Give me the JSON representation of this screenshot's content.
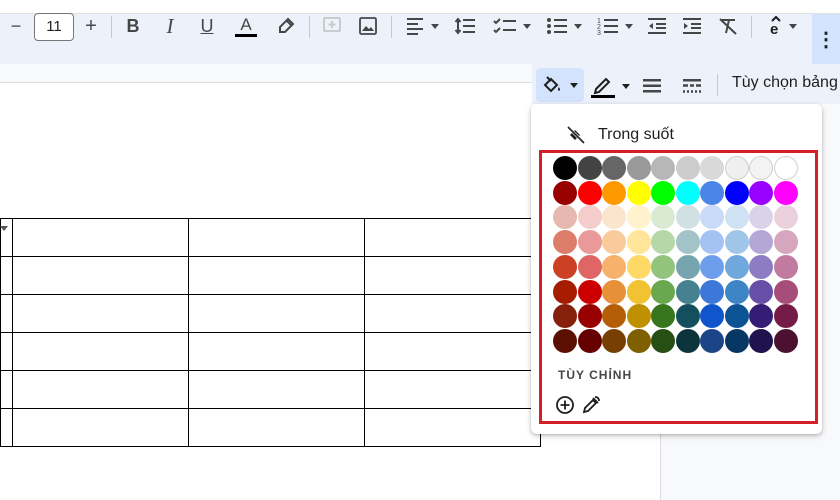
{
  "toolbar": {
    "font_size": "11",
    "minus": "−",
    "plus": "+",
    "bold": "B",
    "italic": "I",
    "underline": "U",
    "text_color": "A",
    "more": "⋮"
  },
  "table_toolbar": {
    "table_options_label": "Tùy chọn bảng"
  },
  "fill_menu": {
    "transparent_label": "Trong suốt",
    "custom_label": "TÙY CHỈNH",
    "colors": [
      [
        "#000000",
        "#434343",
        "#666666",
        "#999999",
        "#b7b7b7",
        "#cccccc",
        "#d9d9d9",
        "#efefef",
        "#f3f3f3",
        "#ffffff"
      ],
      [
        "#980000",
        "#ff0000",
        "#ff9900",
        "#ffff00",
        "#00ff00",
        "#00ffff",
        "#4a86e8",
        "#0000ff",
        "#9900ff",
        "#ff00ff"
      ],
      [
        "#e6b8af",
        "#f4cccc",
        "#fce5cd",
        "#fff2cc",
        "#d9ead3",
        "#d0e0e3",
        "#c9daf8",
        "#cfe2f3",
        "#d9d2e9",
        "#ead1dc"
      ],
      [
        "#dd7e6b",
        "#ea9999",
        "#f9cb9c",
        "#ffe599",
        "#b6d7a8",
        "#a2c4c9",
        "#a4c2f4",
        "#9fc5e8",
        "#b4a7d6",
        "#d5a6bd"
      ],
      [
        "#cc4125",
        "#e06666",
        "#f6b26b",
        "#ffd966",
        "#93c47d",
        "#76a5af",
        "#6d9eeb",
        "#6fa8dc",
        "#8e7cc3",
        "#c27ba0"
      ],
      [
        "#a61c00",
        "#cc0000",
        "#e69138",
        "#f1c232",
        "#6aa84f",
        "#45818e",
        "#3c78d8",
        "#3d85c6",
        "#674ea7",
        "#a64d79"
      ],
      [
        "#85200c",
        "#990000",
        "#b45f06",
        "#bf9000",
        "#38761d",
        "#134f5c",
        "#1155cc",
        "#0b5394",
        "#351c75",
        "#741b47"
      ],
      [
        "#5b0f00",
        "#660000",
        "#783f04",
        "#7f6000",
        "#274e13",
        "#0c343d",
        "#1c4587",
        "#073763",
        "#20124d",
        "#4c1130"
      ]
    ]
  },
  "doc_table": {
    "rows": 6,
    "cols": 4
  }
}
